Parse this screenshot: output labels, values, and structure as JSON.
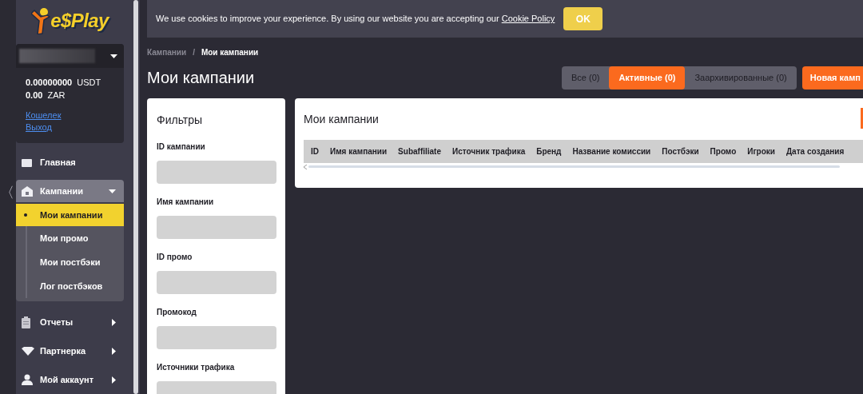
{
  "sidebar": {
    "collapse_glyph": "〈",
    "logo": "e$Play",
    "account": {
      "balances": [
        {
          "amount": "0.00000000",
          "currency": "USDT"
        },
        {
          "amount": "0.00",
          "currency": "ZAR"
        }
      ],
      "links": [
        "Кошелек",
        "Выход"
      ]
    },
    "menu": [
      {
        "label": "Главная",
        "kind": "link"
      },
      {
        "label": "Кампании",
        "kind": "group",
        "expanded": true,
        "children": [
          {
            "label": "Мои кампании",
            "selected": true
          },
          {
            "label": "Мои промо",
            "selected": false
          },
          {
            "label": "Мои постбэки",
            "selected": false
          },
          {
            "label": "Лог постбэков",
            "selected": false
          }
        ]
      },
      {
        "label": "Отчеты",
        "kind": "group",
        "expanded": false
      },
      {
        "label": "Партнерка",
        "kind": "group",
        "expanded": false
      },
      {
        "label": "Мой аккаунт",
        "kind": "group",
        "expanded": false
      }
    ]
  },
  "cookie_bar": {
    "text": "We use cookies to improve your experience. By using our website you are accepting our",
    "link": "Cookie Policy",
    "button": "OK"
  },
  "breadcrumb": {
    "separator": "/",
    "items": [
      {
        "label": "Кампании",
        "current": false
      },
      {
        "label": "Мои кампании",
        "current": true
      }
    ]
  },
  "page_title": "Мои кампании",
  "tabs": [
    {
      "label": "Все (0)",
      "selected": false
    },
    {
      "label": "Активные (0)",
      "selected": true
    },
    {
      "label": "Заархивированные (0)",
      "selected": false
    }
  ],
  "new_button": "Новая камп",
  "filters": {
    "title": "Фильтры",
    "fields": [
      "ID кампании",
      "Имя кампании",
      "ID промо",
      "Промокод",
      "Источники трафика"
    ]
  },
  "table": {
    "title": "Мои кампании",
    "columns": [
      "ID",
      "Имя кампании",
      "Subaffiliate",
      "Источник трафика",
      "Бренд",
      "Название комиссии",
      "Постбэки",
      "Промо",
      "Игроки",
      "Дата создания"
    ]
  }
}
